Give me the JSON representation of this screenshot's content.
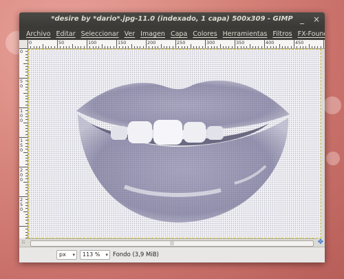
{
  "window": {
    "title": "*desire by *dario*.jpg-11.0 (indexado, 1 capa) 500x309 - GIMP",
    "minimize": "_",
    "close": "×"
  },
  "menu": [
    "Archivo",
    "Editar",
    "Seleccionar",
    "Ver",
    "Imagen",
    "Capa",
    "Colores",
    "Herramientas",
    "Filtros",
    "FX-Foundry"
  ],
  "ruler": {
    "h_labels": [
      "0",
      "50",
      "100",
      "150",
      "200",
      "250",
      "300",
      "350",
      "400",
      "450"
    ],
    "v_labels": [
      "0",
      "50",
      "100",
      "150",
      "200",
      "250"
    ]
  },
  "image": {
    "description_icon": "lips-image"
  },
  "hscroll": {
    "grip": "|||"
  },
  "nav_icon": "navigate-icon",
  "status": {
    "unit": "px",
    "zoom": "113 %",
    "layer_info": "Fondo (3,9 MiB)"
  },
  "colors": {
    "titlebar": "#3c3b37",
    "desktop": "#d9897f",
    "selection_border": "#d7c62a"
  }
}
